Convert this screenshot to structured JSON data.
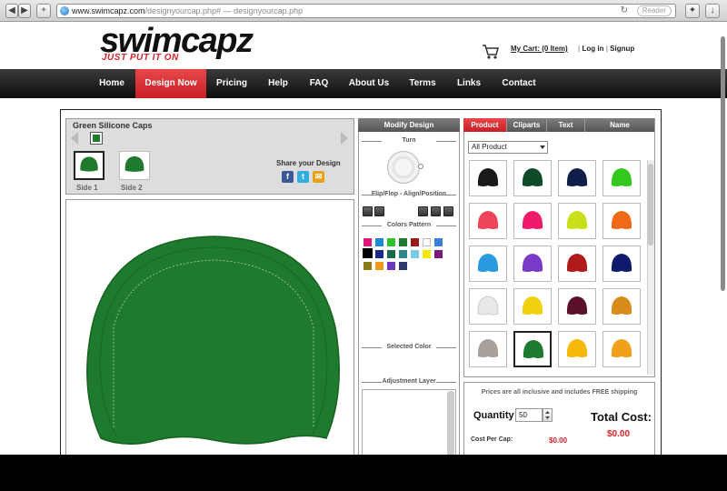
{
  "browser": {
    "url_host": "www.swimcapz.com",
    "url_path": "/designyourcap.php#",
    "url_title": " — designyourcap.php",
    "reader_label": "Reader",
    "back_icon": "◀",
    "forward_icon": "▶",
    "add_icon": "+",
    "reload_icon": "↻"
  },
  "header": {
    "logo_text": "swimcapz",
    "tagline": "JUST PUT IT ON",
    "cart_label": "My Cart: (0 Item)",
    "login_label": "Log in",
    "signup_label": "Signup"
  },
  "nav": {
    "items": [
      "Home",
      "Design Now",
      "Pricing",
      "Help",
      "FAQ",
      "About Us",
      "Terms",
      "Links",
      "Contact"
    ],
    "active": "Design Now"
  },
  "design_panel": {
    "cap_title": "Green Silicone Caps",
    "cap_color": "#1e7a2c",
    "side1_label": "Side 1",
    "side2_label": "Side 2",
    "share_label": "Share your Design",
    "social": {
      "facebook": "f",
      "twitter": "t"
    }
  },
  "modify": {
    "header": "Modify Design",
    "turn_label": "Turn",
    "flip_label": "Flip/Flop - Align/Position",
    "colors_label": "Colors Pattern",
    "selected_color_label": "Selected Color",
    "adjust_label": "Adjustment Layer",
    "palette": [
      "#e0167d",
      "#1e88d8",
      "#2ec02e",
      "#1e7a2c",
      "#9a1a1a",
      "#ffffff",
      "#3a7fd8",
      "#000000",
      "#1a2a8a",
      "#1a6a4a",
      "#2a8a8a",
      "#7ac7e8",
      "#f0e800",
      "#7a1a7a",
      "#8a7a1a",
      "#f09a1a",
      "#6a3aba",
      "#2a3a6a"
    ]
  },
  "products": {
    "tabs": [
      "Product",
      "Cliparts",
      "Text",
      "Name"
    ],
    "active_tab": "Product",
    "filter_value": "All Product",
    "caps": [
      {
        "color": "#1a1a1a"
      },
      {
        "color": "#0e4a2a"
      },
      {
        "color": "#0f1f4a"
      },
      {
        "color": "#32c81e"
      },
      {
        "color": "#f0445a"
      },
      {
        "color": "#f01a6a"
      },
      {
        "color": "#c8e01a"
      },
      {
        "color": "#f06a1a"
      },
      {
        "color": "#2a9ae0"
      },
      {
        "color": "#7a3ac8"
      },
      {
        "color": "#b01a1a"
      },
      {
        "color": "#0f1a6a"
      },
      {
        "color": "#e8e8e8"
      },
      {
        "color": "#f0d00a"
      },
      {
        "color": "#5a0f2a"
      },
      {
        "color": "#d88a1a"
      },
      {
        "color": "#a8a09a"
      },
      {
        "color": "#1e7a2c",
        "selected": true
      },
      {
        "color": "#f8b80a"
      },
      {
        "color": "#f0a01a"
      }
    ]
  },
  "pricing": {
    "note": "Prices are all inclusive and includes FREE shipping",
    "quantity_label": "Quantity",
    "quantity_value": "50",
    "total_label": "Total Cost:",
    "total_value": "$0.00",
    "cost_per_cap_label": "Cost Per Cap:",
    "cost_per_cap_value": "$0.00"
  }
}
